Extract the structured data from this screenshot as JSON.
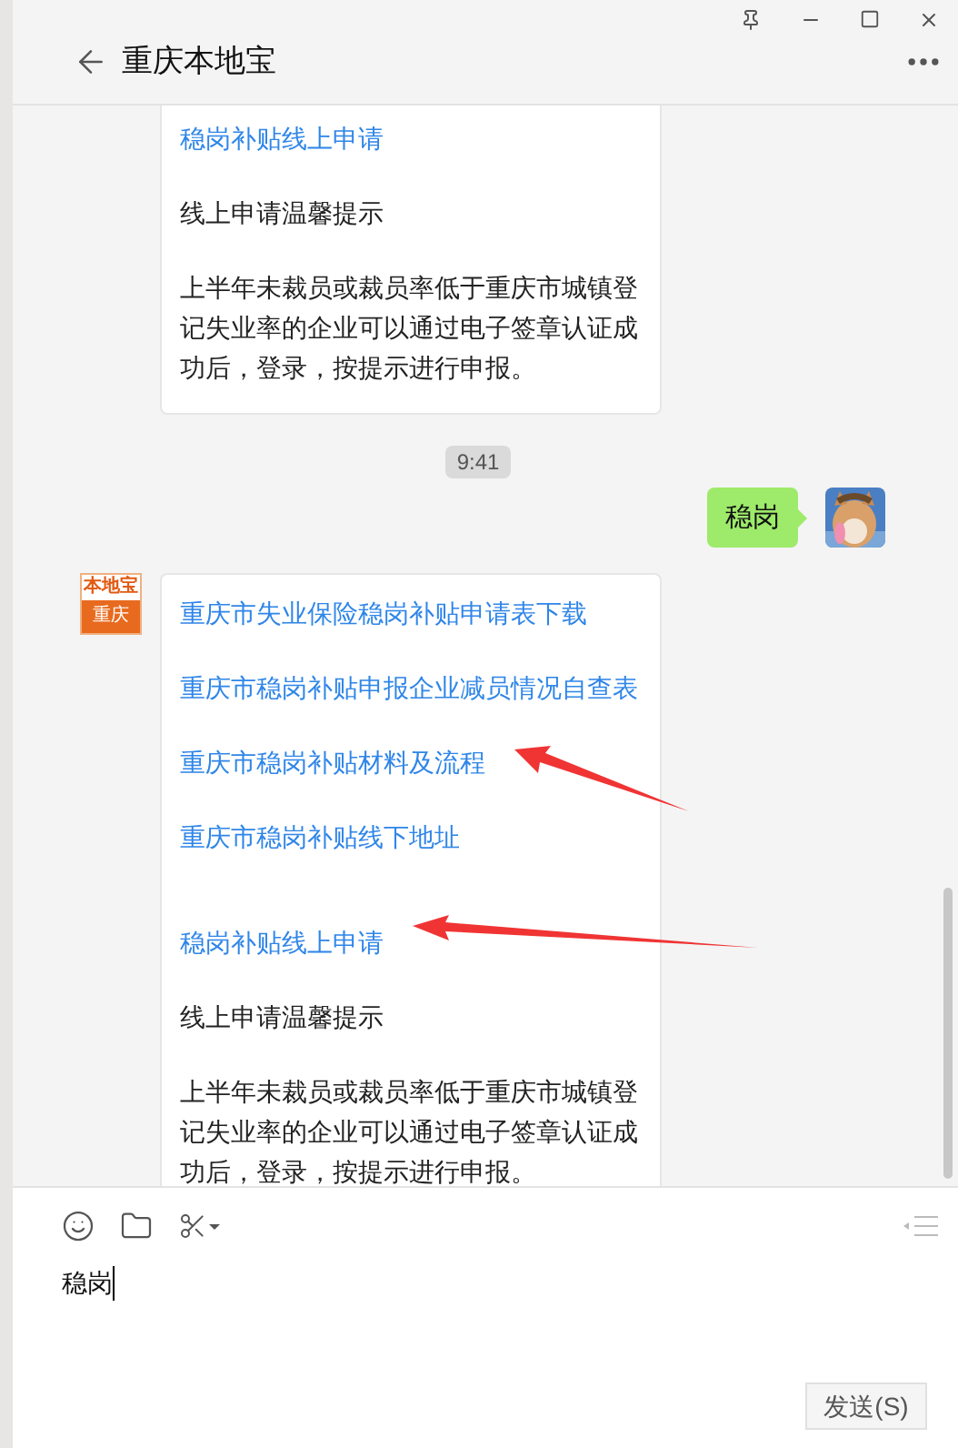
{
  "window": {
    "title": "重庆本地宝"
  },
  "messages": [
    {
      "kind": "card",
      "groups": [
        {
          "lines": [
            {
              "kind": "link",
              "text": "稳岗补贴线上申请",
              "marked": false
            },
            {
              "kind": "text",
              "text": "线上申请温馨提示",
              "marked": false
            },
            {
              "kind": "text",
              "text": "上半年未裁员或裁员率低于重庆市城镇登记失业率的企业可以通过电子签章认证成功后，登录，按提示进行申报。",
              "marked": false
            }
          ]
        }
      ]
    },
    {
      "kind": "time",
      "text": "9:41"
    },
    {
      "kind": "bubble",
      "text": "稳岗"
    },
    {
      "kind": "card",
      "avatar": {
        "kind": "logo",
        "top": "本地宝",
        "bottom": "重庆"
      },
      "groups": [
        {
          "lines": [
            {
              "kind": "link",
              "text": "重庆市失业保险稳岗补贴申请表下载",
              "marked": false
            },
            {
              "kind": "link",
              "text": "重庆市稳岗补贴申报企业减员情况自查表",
              "marked": false
            },
            {
              "kind": "link",
              "text": "重庆市稳岗补贴材料及流程",
              "marked": true
            },
            {
              "kind": "link",
              "text": "重庆市稳岗补贴线下地址",
              "marked": false
            }
          ]
        },
        {
          "lines": [
            {
              "kind": "link",
              "text": "稳岗补贴线上申请",
              "marked": true
            },
            {
              "kind": "text",
              "text": "线上申请温馨提示",
              "marked": false
            },
            {
              "kind": "text",
              "text": "上半年未裁员或裁员率低于重庆市城镇登记失业率的企业可以通过电子签章认证成功后，登录，按提示进行申报。",
              "marked": false
            }
          ]
        }
      ]
    }
  ],
  "input": {
    "value": "稳岗"
  },
  "send_button": "发送(S)"
}
